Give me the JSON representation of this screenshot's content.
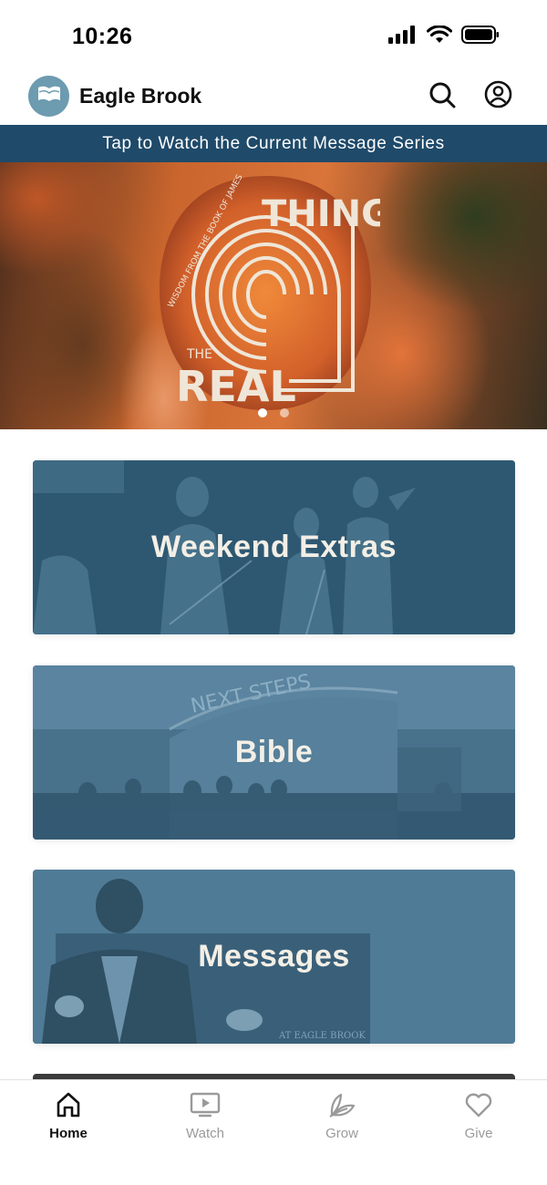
{
  "status_bar": {
    "time": "10:26"
  },
  "app": {
    "title": "Eagle Brook"
  },
  "banner": {
    "text": "Tap to Watch the Current Message Series"
  },
  "hero": {
    "series_title_top": "THING",
    "series_title_small": "THE",
    "series_title_bottom": "REAL",
    "series_subtitle": "WISDOM FROM THE BOOK OF JAMES",
    "page_count": 2,
    "active_page": 1
  },
  "cards": [
    {
      "label": "Weekend Extras"
    },
    {
      "label": "Bible",
      "background_text": "NEXT STEPS"
    },
    {
      "label": "Messages",
      "background_text": "AT EAGLE BROOK"
    }
  ],
  "tabs": [
    {
      "label": "Home",
      "icon": "home-icon",
      "active": true
    },
    {
      "label": "Watch",
      "icon": "play-screen-icon",
      "active": false
    },
    {
      "label": "Grow",
      "icon": "leaf-icon",
      "active": false
    },
    {
      "label": "Give",
      "icon": "heart-icon",
      "active": false
    }
  ],
  "colors": {
    "banner": "#1f4a6a",
    "logo": "#6d9bb0",
    "card_tint": "#2f5a74",
    "tab_active": "#111111",
    "tab_inactive": "#9a9a9a"
  }
}
